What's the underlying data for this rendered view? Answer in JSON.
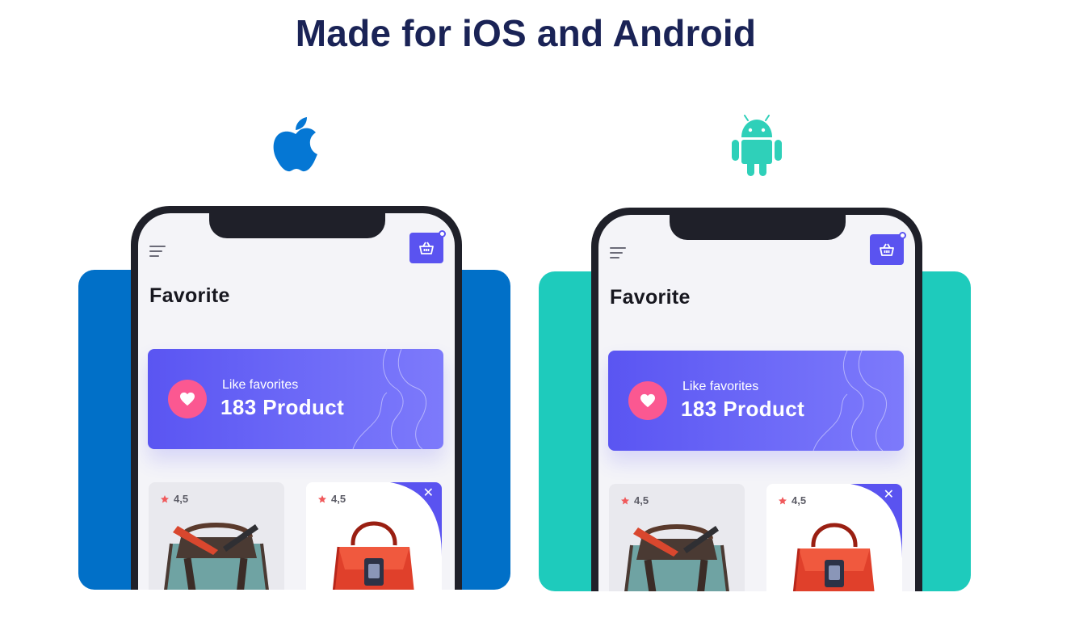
{
  "headline": "Made for iOS and Android",
  "colors": {
    "headline": "#1a2356",
    "ios_backdrop": "#0170c8",
    "android_backdrop": "#1ecbbc",
    "apple_logo": "#0577d4",
    "android_logo": "#2fd0b9",
    "accent": "#5a53f0",
    "heart": "#fb5891",
    "star": "#f0595b"
  },
  "platforms": [
    {
      "name": "iOS",
      "logo_icon": "apple-logo-icon",
      "screen": {
        "title": "Favorite",
        "promo": {
          "subtitle": "Like favorites",
          "count": "183 Product"
        },
        "products": [
          {
            "rating": "4,5",
            "image": "teal-handbag"
          },
          {
            "rating": "4,5",
            "image": "red-handbag",
            "removable": true
          }
        ]
      }
    },
    {
      "name": "Android",
      "logo_icon": "android-robot-icon",
      "screen": {
        "title": "Favorite",
        "promo": {
          "subtitle": "Like favorites",
          "count": "183 Product"
        },
        "products": [
          {
            "rating": "4,5",
            "image": "teal-handbag"
          },
          {
            "rating": "4,5",
            "image": "red-handbag",
            "removable": true
          }
        ]
      }
    }
  ]
}
